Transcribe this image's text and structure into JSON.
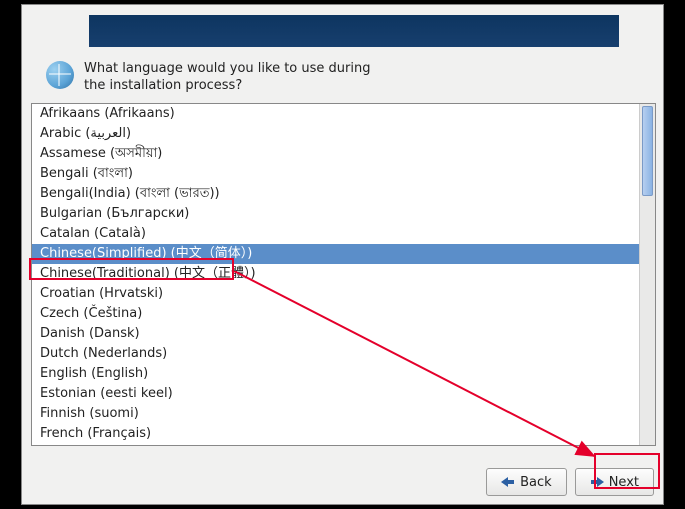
{
  "prompt": "What language would you like to use during the installation process?",
  "languages": [
    "Afrikaans (Afrikaans)",
    "Arabic (العربية)",
    "Assamese (অসমীয়া)",
    "Bengali (বাংলা)",
    "Bengali(India) (বাংলা (ভারত))",
    "Bulgarian (Български)",
    "Catalan (Català)",
    "Chinese(Simplified) (中文（简体）)",
    "Chinese(Traditional) (中文（正體）)",
    "Croatian (Hrvatski)",
    "Czech (Čeština)",
    "Danish (Dansk)",
    "Dutch (Nederlands)",
    "English (English)",
    "Estonian (eesti keel)",
    "Finnish (suomi)",
    "French (Français)"
  ],
  "selected_index": 7,
  "buttons": {
    "back": "Back",
    "next": "Next"
  },
  "annotation": {
    "highlight_selected": true,
    "highlight_next": true
  }
}
